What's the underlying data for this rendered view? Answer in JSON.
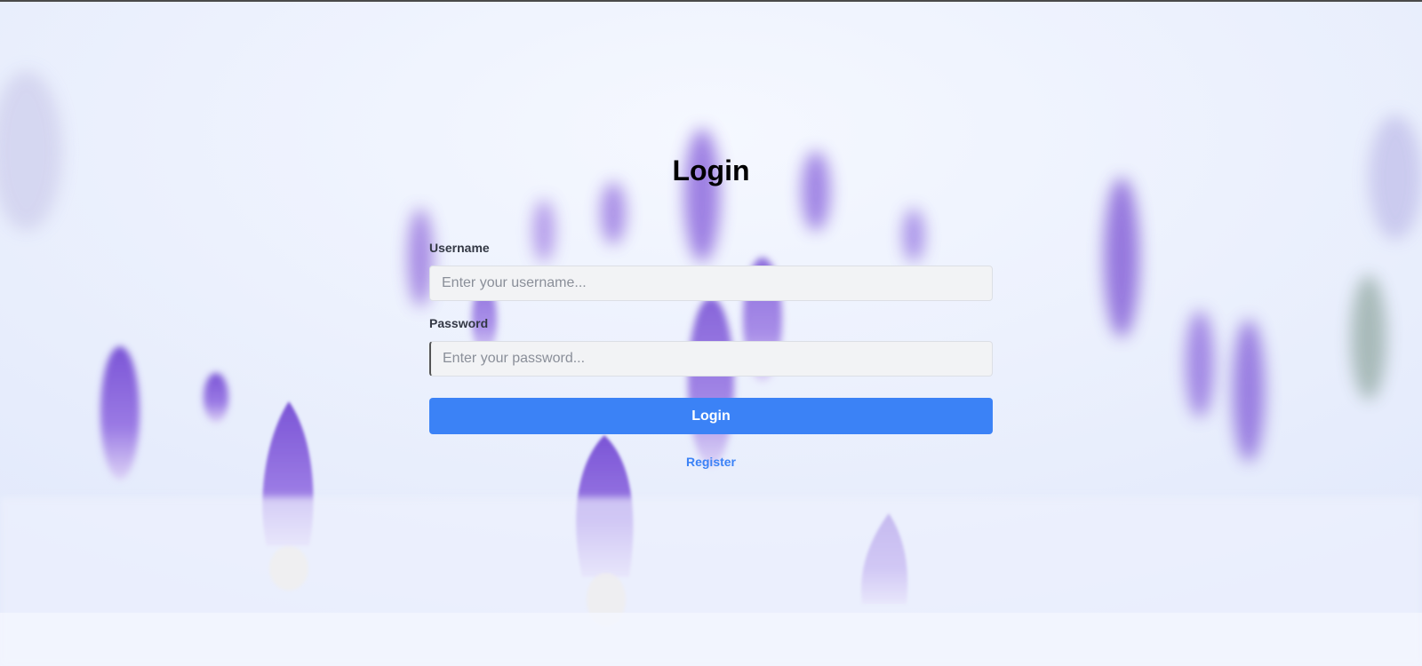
{
  "page": {
    "title": "Login"
  },
  "form": {
    "username_label": "Username",
    "username_placeholder": "Enter your username...",
    "username_value": "",
    "password_label": "Password",
    "password_placeholder": "Enter your password...",
    "password_value": "",
    "login_button_label": "Login",
    "register_link_label": "Register"
  },
  "colors": {
    "accent": "#3b82f6",
    "input_background": "#f2f3f5",
    "crocus_purple": "#8a62d8"
  },
  "background": {
    "subject": "purple crocus buds in snow"
  }
}
